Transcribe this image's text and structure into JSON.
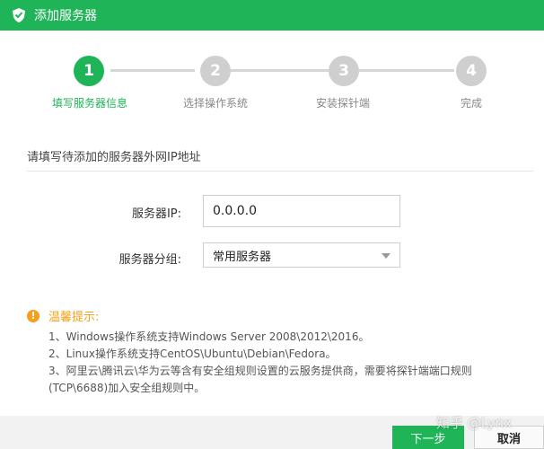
{
  "window": {
    "title": "添加服务器"
  },
  "colors": {
    "accent": "#1fb457",
    "inactive": "#cfcfcf",
    "warning": "#f4a01c"
  },
  "steps": [
    {
      "number": "1",
      "label": "填写服务器信息",
      "active": true
    },
    {
      "number": "2",
      "label": "选择操作系统",
      "active": false
    },
    {
      "number": "3",
      "label": "安装探针端",
      "active": false
    },
    {
      "number": "4",
      "label": "完成",
      "active": false
    }
  ],
  "form": {
    "instruction": "请填写待添加的服务器外网IP地址",
    "ip_label": "服务器IP:",
    "ip_value": "0.0.0.0",
    "group_label": "服务器分组:",
    "group_value": "常用服务器"
  },
  "tips": {
    "title": "温馨提示:",
    "lines": [
      "1、Windows操作系统支持Windows Server 2008\\2012\\2016。",
      "2、Linux操作系统支持CentOS\\Ubuntu\\Debian\\Fedora。",
      "3、阿里云\\腾讯云\\华为云等含有安全组规则设置的云服务提供商，需要将探针端端口规则",
      "(TCP\\6688)加入安全组规则中。"
    ]
  },
  "buttons": {
    "next": "下一步",
    "cancel": "取消"
  },
  "watermark": "知乎 @Lynx",
  "icons": {
    "logo": "shield-logo-icon",
    "warning": "warning-icon",
    "dropdown": "chevron-down-icon"
  }
}
